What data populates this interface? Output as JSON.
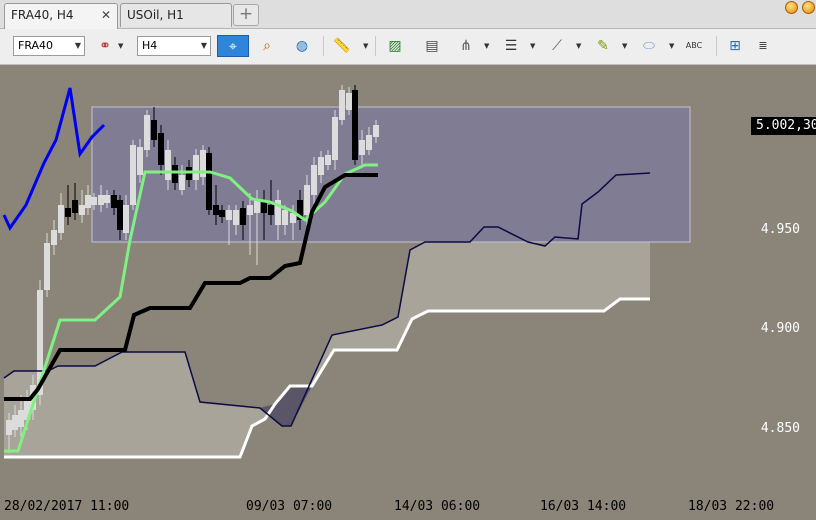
{
  "tabs": [
    {
      "label": "FRA40, H4",
      "active": true,
      "close": "✕"
    },
    {
      "label": "USOil, H1",
      "active": false
    }
  ],
  "add_tab_label": "+",
  "toolbar": {
    "symbol": "FRA40",
    "timeframe": "H4",
    "icons": [
      "link-icon",
      "crosshair-icon",
      "zoom-icon",
      "globe-icon",
      "ruler-icon",
      "image-icon",
      "template-icon",
      "indicator-icon",
      "lines-icon",
      "fan-icon",
      "pen-icon",
      "ellipse-icon",
      "text-icon",
      "hierarchy-icon",
      "list-icon"
    ]
  },
  "price_badge": "5.002,30",
  "y_axis": [
    "4.950",
    "4.900",
    "4.850"
  ],
  "x_axis": [
    "28/02/2017 11:00",
    "09/03 07:00",
    "14/03 06:00",
    "16/03 14:00",
    "18/03 22:00"
  ],
  "colors": {
    "background": "#8a8578",
    "rectangle": "#7f7c93",
    "cloud": "#a9a49a",
    "tenkan": "#80f080",
    "kijun": "#000000",
    "chikou": "#0000ee",
    "span_a": "#ffffff",
    "span_b": "#0b0b45"
  }
}
